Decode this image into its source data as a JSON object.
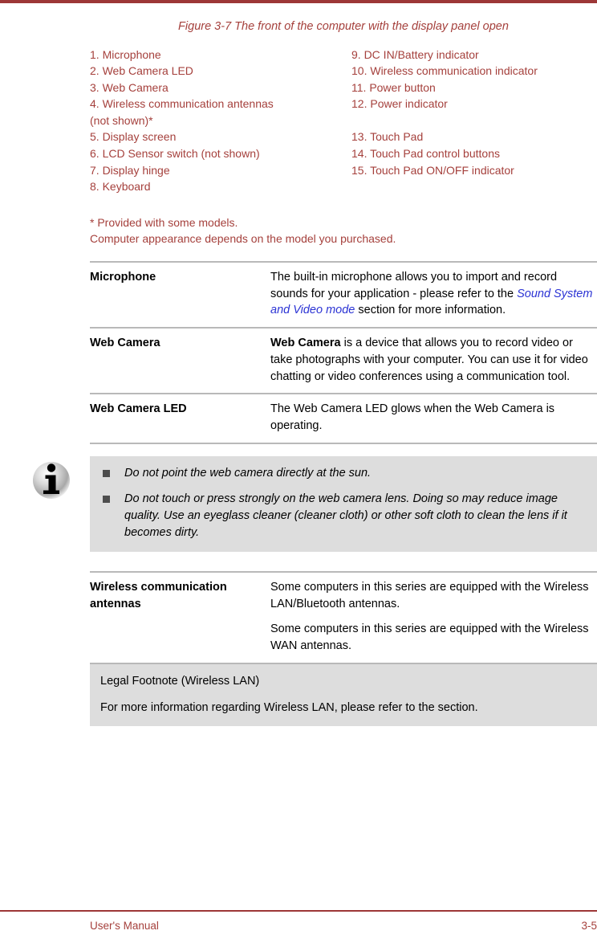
{
  "figure": {
    "caption": "Figure 3-7 The front of the computer with the display panel open"
  },
  "legend": {
    "left_column": [
      "1. Microphone",
      "2. Web Camera LED",
      "3. Web Camera",
      "4. Wireless communication antennas\n(not shown)*",
      "5. Display screen",
      "6. LCD Sensor switch (not shown)",
      "7. Display hinge",
      "8. Keyboard"
    ],
    "right_column": [
      "9. DC IN/Battery indicator",
      "10. Wireless communication indicator",
      "11. Power button",
      "12. Power indicator",
      "13. Touch Pad",
      "14. Touch Pad control buttons",
      "15. Touch Pad ON/OFF indicator"
    ]
  },
  "notes": {
    "line1": "* Provided with some models.",
    "line2": "Computer appearance depends on the model you purchased."
  },
  "table1": {
    "rows": [
      {
        "term": "Microphone",
        "def_before": "The built-in microphone allows you to import and record sounds for your application - please refer to the ",
        "def_link": "Sound System and Video mode",
        "def_after": " section for more information."
      },
      {
        "term": "Web Camera",
        "def_bold": "Web Camera",
        "def_rest": " is a device that allows you to record video or take photographs with your computer. You can use it for video chatting or video conferences using a communication tool."
      },
      {
        "term": "Web Camera LED",
        "def": "The Web Camera LED glows when the Web Camera is operating."
      }
    ]
  },
  "note_box": {
    "icon": "info-icon",
    "items": [
      "Do not point the web camera directly at the sun.",
      "Do not touch or press strongly on the web camera lens. Doing so may reduce image quality. Use an eyeglass cleaner (cleaner cloth) or other soft cloth to clean the lens if it becomes dirty."
    ]
  },
  "table2": {
    "row": {
      "term": "Wireless communication antennas",
      "para1": "Some computers in this series are equipped with the Wireless LAN/Bluetooth antennas.",
      "para2": "Some computers in this series are equipped with the Wireless WAN antennas."
    }
  },
  "legal": {
    "title": "Legal Footnote (Wireless LAN)",
    "body": "For more information regarding Wireless LAN, please refer to the section."
  },
  "footer": {
    "left": "User's Manual",
    "right": "3-5"
  },
  "colors": {
    "accent_red": "#a5403c",
    "rule_red": "#9d3737",
    "link_blue": "#2b33d4",
    "note_bg": "#dddddd",
    "table_rule": "#b9b9b9"
  }
}
